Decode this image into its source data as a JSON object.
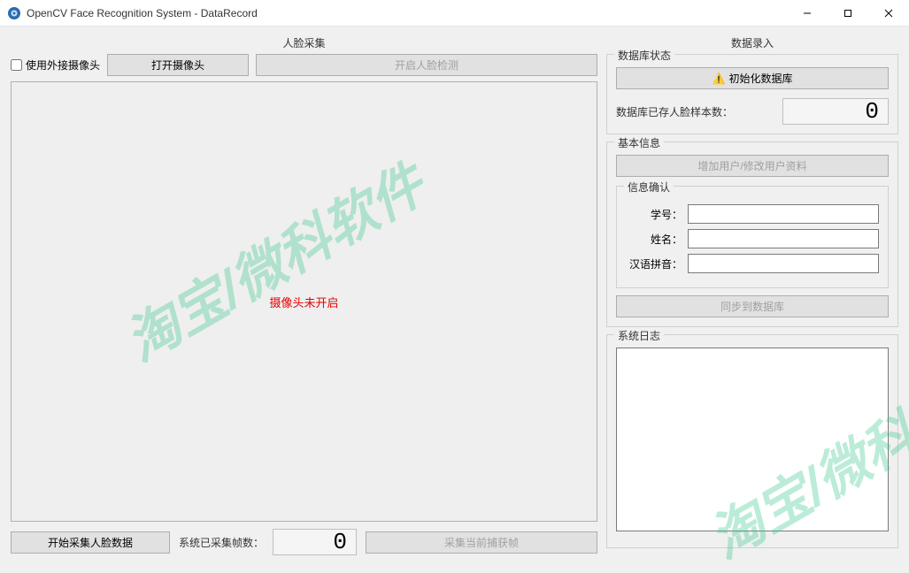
{
  "window": {
    "title": "OpenCV Face Recognition System - DataRecord"
  },
  "left": {
    "section_title": "人脸采集",
    "use_external_cam": "使用外接摄像头",
    "open_camera": "打开摄像头",
    "start_detect": "开启人脸检测",
    "camera_status": "摄像头未开启",
    "start_collect": "开始采集人脸数据",
    "frames_label": "系统已采集帧数：",
    "frames_value": "0",
    "capture_current": "采集当前捕获帧"
  },
  "right": {
    "section_title": "数据录入",
    "db_status": {
      "title": "数据库状态",
      "init_db": "初始化数据库",
      "stored_label": "数据库已存人脸样本数：",
      "stored_value": "0"
    },
    "basic": {
      "title": "基本信息",
      "add_user": "增加用户/修改用户资料",
      "confirm_title": "信息确认",
      "id_label": "学号：",
      "name_label": "姓名：",
      "pinyin_label": "汉语拼音：",
      "sync": "同步到数据库",
      "id_value": "",
      "name_value": "",
      "pinyin_value": ""
    },
    "log": {
      "title": "系统日志",
      "content": ""
    }
  },
  "watermark": "淘宝/微科软件"
}
